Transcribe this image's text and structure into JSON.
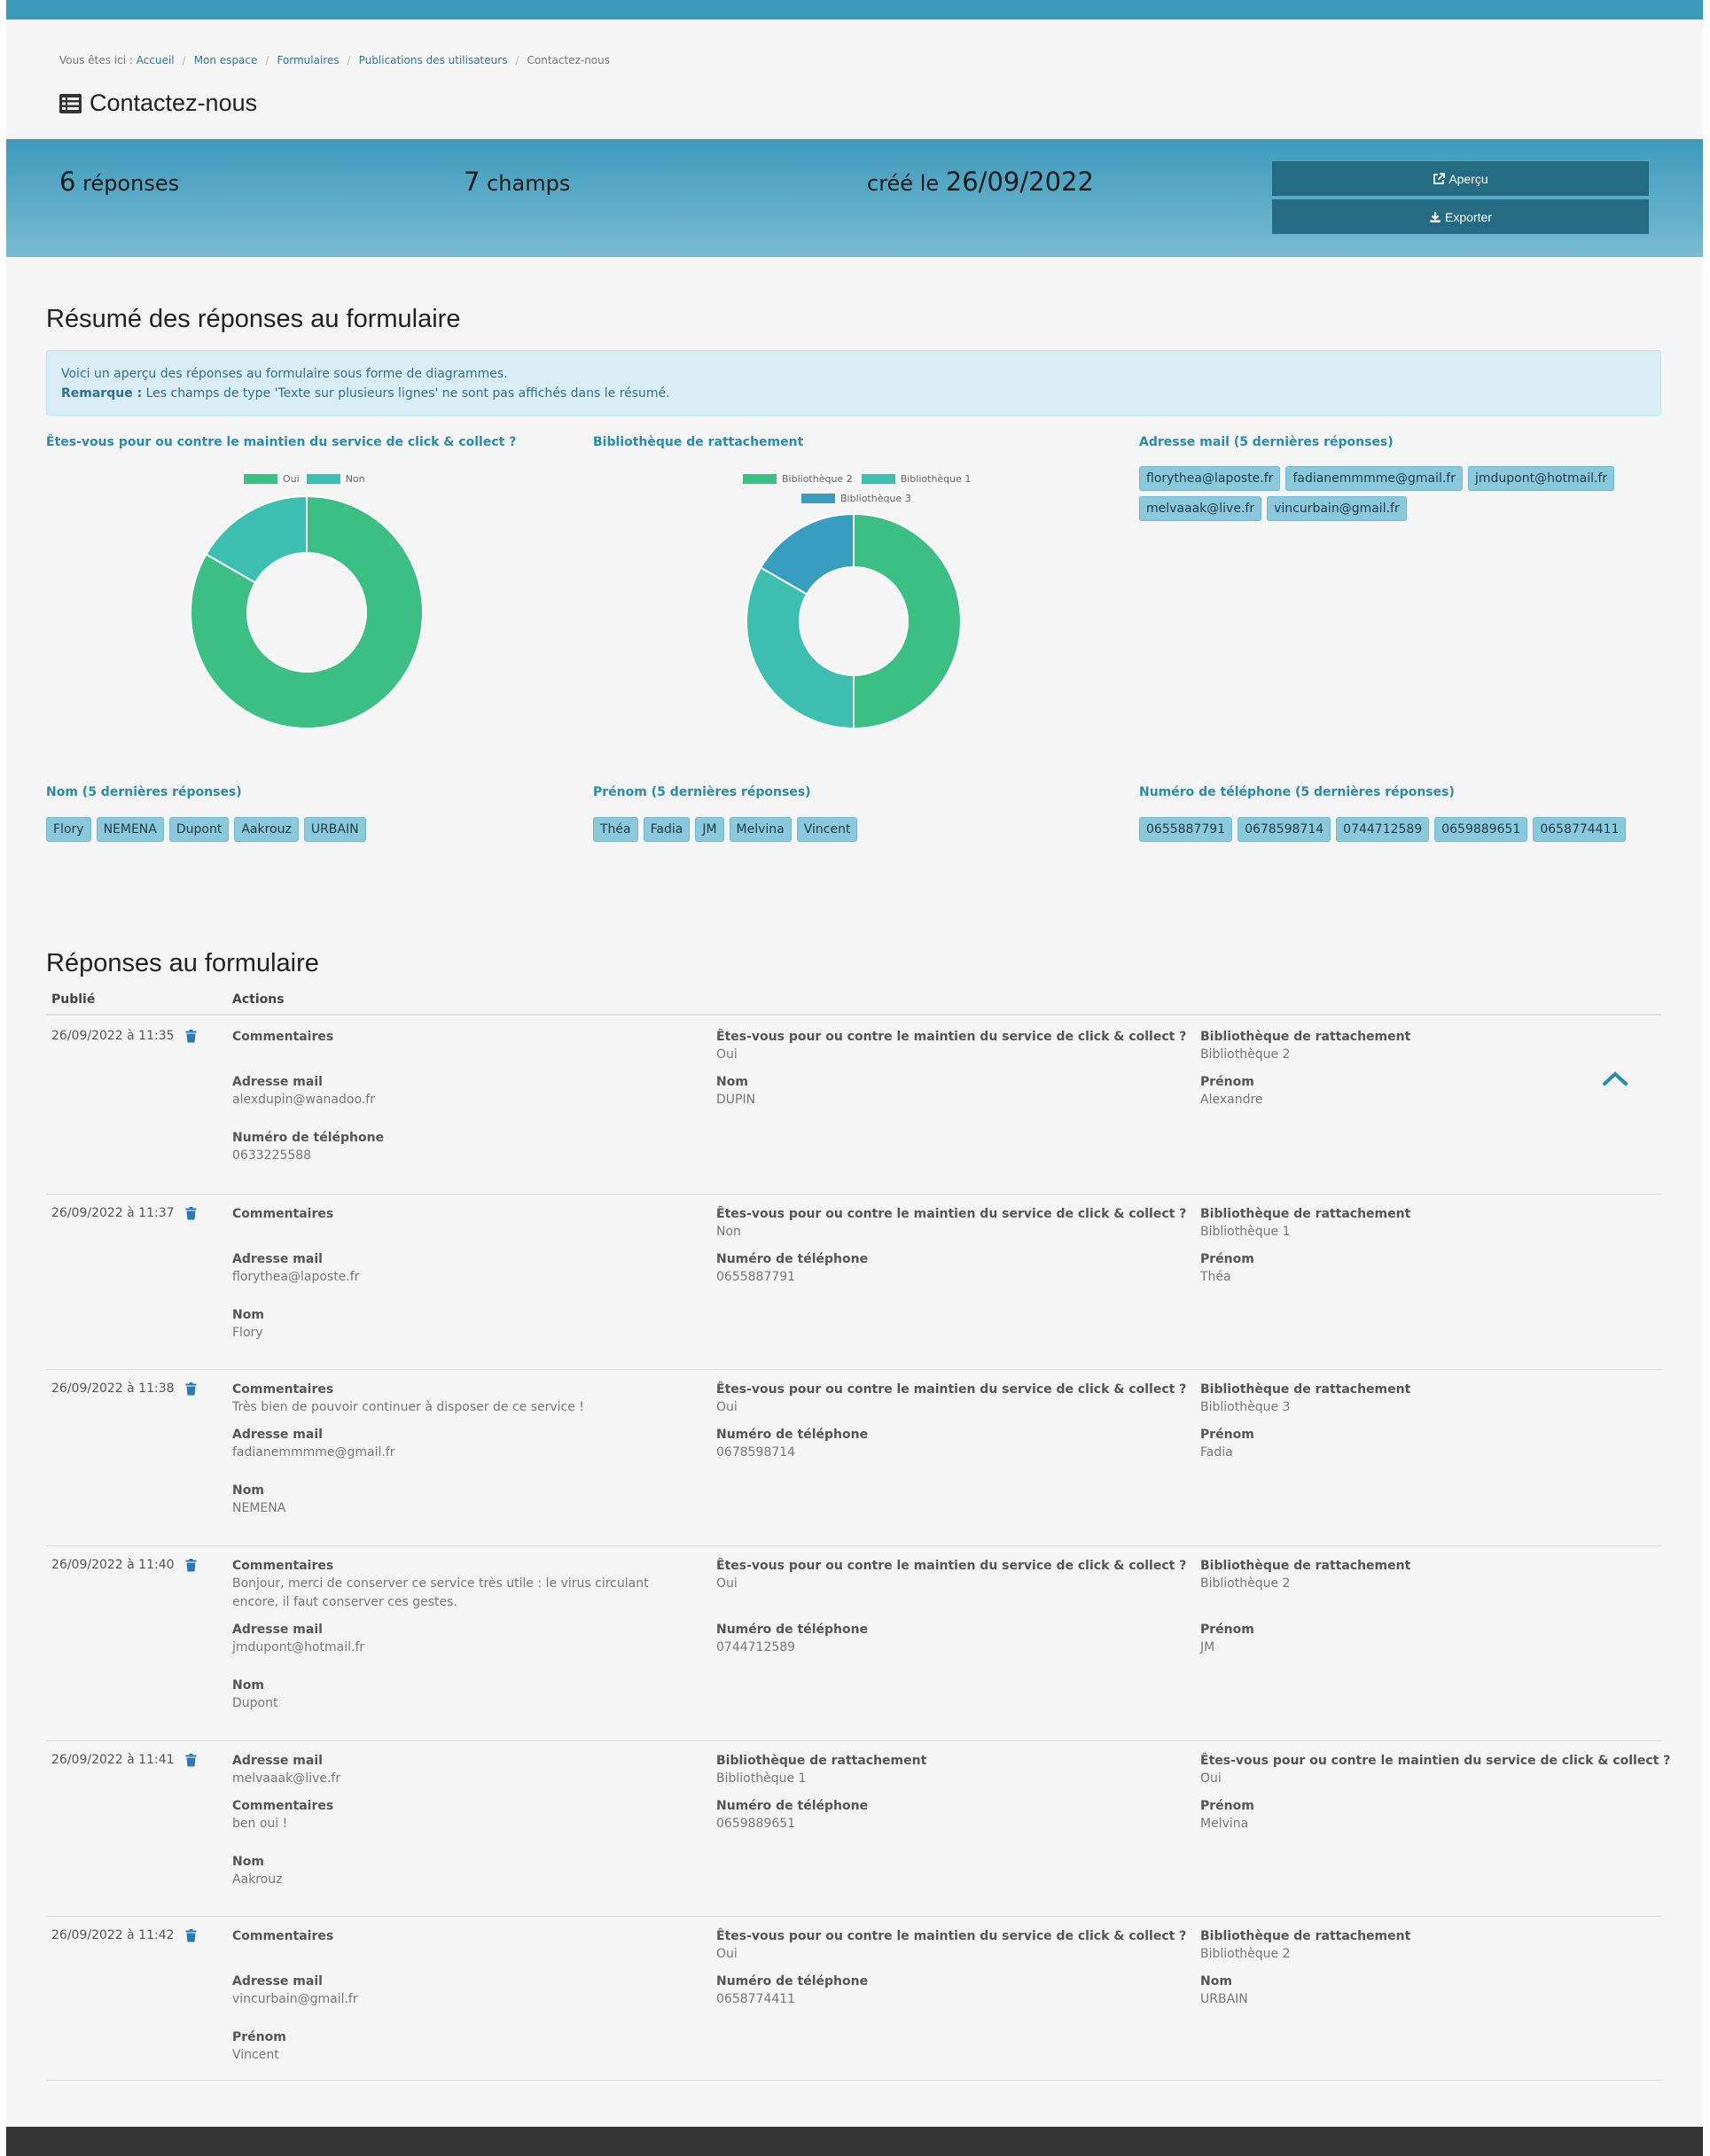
{
  "breadcrumb": {
    "prefix": "Vous êtes ici :",
    "items": [
      "Accueil",
      "Mon espace",
      "Formulaires",
      "Publications des utilisateurs"
    ],
    "current": "Contactez-nous"
  },
  "page_title": "Contactez-nous",
  "stats": {
    "responses_count": "6",
    "responses_label": "réponses",
    "fields_count": "7",
    "fields_label": "champs",
    "created_label": "créé le",
    "created_date": "26/09/2022"
  },
  "buttons": {
    "preview": "Aperçu",
    "export": "Exporter"
  },
  "summary": {
    "title": "Résumé des réponses au formulaire",
    "info_line1": "Voici un aperçu des réponses au formulaire sous forme de diagrammes.",
    "info_remark_label": "Remarque :",
    "info_remark_text": "Les champs de type 'Texte sur plusieurs lignes' ne sont pas affichés dans le résumé.",
    "q_click": "Êtes-vous pour ou contre le maintien du service de click & collect ?",
    "q_bibli": "Bibliothèque de rattachement",
    "q_mail": "Adresse mail (5 dernières réponses)",
    "q_nom": "Nom (5 dernières réponses)",
    "q_prenom": "Prénom (5 dernières réponses)",
    "q_tel": "Numéro de téléphone (5 dernières réponses)",
    "tags_mail": [
      "florythea@laposte.fr",
      "fadianemmmme@gmail.fr",
      "jmdupont@hotmail.fr",
      "melvaaak@live.fr",
      "vincurbain@gmail.fr"
    ],
    "tags_nom": [
      "Flory",
      "NEMENA",
      "Dupont",
      "Aakrouz",
      "URBAIN"
    ],
    "tags_prenom": [
      "Théa",
      "Fadia",
      "JM",
      "Melvina",
      "Vincent"
    ],
    "tags_tel": [
      "0655887791",
      "0678598714",
      "0744712589",
      "0659889651",
      "0658774411"
    ]
  },
  "chart_data": [
    {
      "type": "pie",
      "title": "Êtes-vous pour ou contre le maintien du service de click & collect ?",
      "categories": [
        "Oui",
        "Non"
      ],
      "values": [
        5,
        1
      ],
      "colors": [
        "#3bbf83",
        "#3cbfb0"
      ],
      "legend": "top"
    },
    {
      "type": "pie",
      "title": "Bibliothèque de rattachement",
      "categories": [
        "Bibliothèque 2",
        "Bibliothèque 1",
        "Bibliothèque 3"
      ],
      "values": [
        3,
        2,
        1
      ],
      "colors": [
        "#3bbf83",
        "#3cbfb0",
        "#389ec0"
      ],
      "legend": "top"
    }
  ],
  "responses": {
    "title": "Réponses au formulaire",
    "col_published": "Publié",
    "col_actions": "Actions",
    "rows": [
      {
        "date": "26/09/2022 à 11:35",
        "f1_lab": "Commentaires",
        "f1_val": "",
        "f2_lab": "Êtes-vous pour ou contre le maintien du service de click & collect ?",
        "f2_val": "Oui",
        "f3_lab": "Bibliothèque de rattachement",
        "f3_val": "Bibliothèque 2",
        "f4_lab": "Adresse mail",
        "f4_val": "alexdupin@wanadoo.fr",
        "f5_lab": "Nom",
        "f5_val": "DUPIN",
        "f6_lab": "Prénom",
        "f6_val": "Alexandre",
        "f7_lab": "Numéro de téléphone",
        "f7_val": "0633225588"
      },
      {
        "date": "26/09/2022 à 11:37",
        "f1_lab": "Commentaires",
        "f1_val": "",
        "f2_lab": "Êtes-vous pour ou contre le maintien du service de click & collect ?",
        "f2_val": "Non",
        "f3_lab": "Bibliothèque de rattachement",
        "f3_val": "Bibliothèque 1",
        "f4_lab": "Adresse mail",
        "f4_val": "florythea@laposte.fr",
        "f5_lab": "Numéro de téléphone",
        "f5_val": "0655887791",
        "f6_lab": "Prénom",
        "f6_val": "Théa",
        "f7_lab": "Nom",
        "f7_val": "Flory"
      },
      {
        "date": "26/09/2022 à 11:38",
        "f1_lab": "Commentaires",
        "f1_val": "Très bien de pouvoir continuer à disposer de ce service !",
        "f2_lab": "Êtes-vous pour ou contre le maintien du service de click & collect ?",
        "f2_val": "Oui",
        "f3_lab": "Bibliothèque de rattachement",
        "f3_val": "Bibliothèque 3",
        "f4_lab": "Adresse mail",
        "f4_val": "fadianemmmme@gmail.fr",
        "f5_lab": "Numéro de téléphone",
        "f5_val": "0678598714",
        "f6_lab": "Prénom",
        "f6_val": "Fadia",
        "f7_lab": "Nom",
        "f7_val": "NEMENA"
      },
      {
        "date": "26/09/2022 à 11:40",
        "f1_lab": "Commentaires",
        "f1_val": "Bonjour, merci de conserver ce service très utile : le virus circulant encore, il faut conserver ces gestes.",
        "f2_lab": "Êtes-vous pour ou contre le maintien du service de click & collect ?",
        "f2_val": "Oui",
        "f3_lab": "Bibliothèque de rattachement",
        "f3_val": "Bibliothèque 2",
        "f4_lab": "Adresse mail",
        "f4_val": "jmdupont@hotmail.fr",
        "f5_lab": "Numéro de téléphone",
        "f5_val": "0744712589",
        "f6_lab": "Prénom",
        "f6_val": "JM",
        "f7_lab": "Nom",
        "f7_val": "Dupont"
      },
      {
        "date": "26/09/2022 à 11:41",
        "f1_lab": "Adresse mail",
        "f1_val": "melvaaak@live.fr",
        "f2_lab": "Bibliothèque de rattachement",
        "f2_val": "Bibliothèque 1",
        "f3_lab": "Êtes-vous pour ou contre le maintien du service de click & collect ?",
        "f3_val": "Oui",
        "f4_lab": "Commentaires",
        "f4_val": "ben oui !",
        "f5_lab": "Numéro de téléphone",
        "f5_val": "0659889651",
        "f6_lab": "Prénom",
        "f6_val": "Melvina",
        "f7_lab": "Nom",
        "f7_val": "Aakrouz"
      },
      {
        "date": "26/09/2022 à 11:42",
        "f1_lab": "Commentaires",
        "f1_val": "",
        "f2_lab": "Êtes-vous pour ou contre le maintien du service de click & collect ?",
        "f2_val": "Oui",
        "f3_lab": "Bibliothèque de rattachement",
        "f3_val": "Bibliothèque 2",
        "f4_lab": "Adresse mail",
        "f4_val": "vincurbain@gmail.fr",
        "f5_lab": "Numéro de téléphone",
        "f5_val": "0658774411",
        "f6_lab": "Nom",
        "f6_val": "URBAIN",
        "f7_lab": "Prénom",
        "f7_val": "Vincent"
      }
    ]
  }
}
